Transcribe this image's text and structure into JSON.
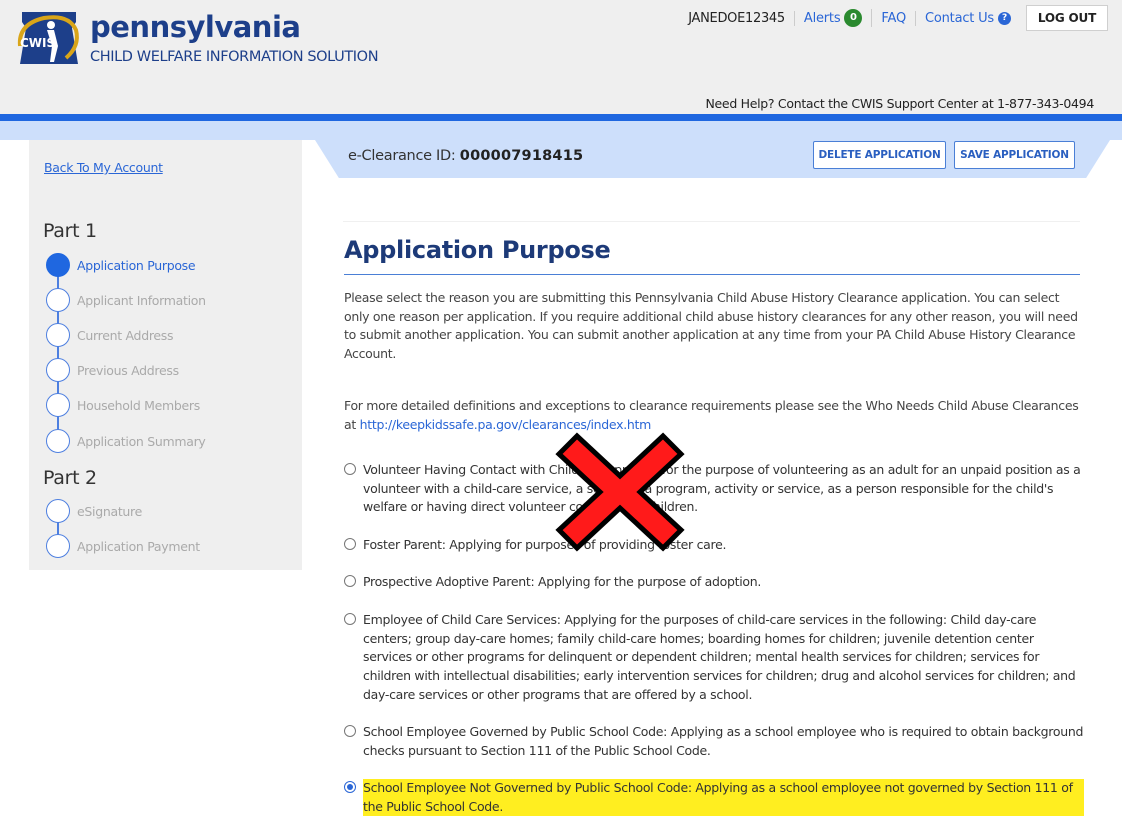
{
  "header": {
    "brand_name": "pennsylvania",
    "brand_subtitle": "CHILD WELFARE INFORMATION SOLUTION",
    "logo_text": "CWIS",
    "username": "JANEDOE12345",
    "alerts_label": "Alerts",
    "alerts_count": "0",
    "faq_label": "FAQ",
    "contact_label": "Contact Us",
    "contact_icon": "?",
    "logout_label": "LOG OUT",
    "support_text": "Need Help? Contact the CWIS Support Center at 1-877-343-0494"
  },
  "content_header": {
    "eclearance_label": "e-Clearance ID:",
    "eclearance_id": "000007918415",
    "delete_label": "DELETE APPLICATION",
    "save_label": "SAVE APPLICATION"
  },
  "sidebar": {
    "back_link": "Back To My Account",
    "parts": [
      {
        "title": "Part 1",
        "steps": [
          {
            "label": "Application Purpose",
            "active": true
          },
          {
            "label": "Applicant Information",
            "active": false
          },
          {
            "label": "Current Address",
            "active": false
          },
          {
            "label": "Previous Address",
            "active": false
          },
          {
            "label": "Household Members",
            "active": false
          },
          {
            "label": "Application Summary",
            "active": false
          }
        ]
      },
      {
        "title": "Part 2",
        "steps": [
          {
            "label": "eSignature",
            "active": false
          },
          {
            "label": "Application Payment",
            "active": false
          }
        ]
      }
    ]
  },
  "main": {
    "title": "Application Purpose",
    "intro": "Please select the reason you are submitting this Pennsylvania Child Abuse History Clearance application. You can select only one reason per application. If you require additional child abuse history clearances for any other reason, you will need to submit another application. You can submit another application at any time from your PA Child Abuse History Clearance Account.",
    "definitions_text": "For more detailed definitions and exceptions to clearance requirements please see the Who Needs Child Abuse Clearances at ",
    "definitions_link": "http://keepkidssafe.pa.gov/clearances/index.htm",
    "options": [
      {
        "text": "Volunteer Having Contact with Children: Applying for the purpose of volunteering as an adult for an unpaid position as a volunteer with a child-care service, a school or a program, activity or service, as a person responsible for the child's welfare or having direct volunteer contact with children.",
        "selected": false
      },
      {
        "text": "Foster Parent: Applying for purposes of providing foster care.",
        "selected": false
      },
      {
        "text": "Prospective Adoptive Parent: Applying for the purpose of adoption.",
        "selected": false
      },
      {
        "text": "Employee of Child Care Services: Applying for the purposes of child-care services in the following: Child day-care centers; group day-care homes; family child-care homes; boarding homes for children; juvenile detention center services or other programs for delinquent or dependent children; mental health services for children; services for children with intellectual disabilities; early intervention services for children; drug and alcohol services for children; and day-care services or other programs that are offered by a school.",
        "selected": false
      },
      {
        "text": "School Employee Governed by Public School Code: Applying as a school employee who is required to obtain background checks pursuant to Section 111 of the Public School Code.",
        "selected": false
      },
      {
        "text": "School Employee Not Governed by Public School Code: Applying as a school employee not governed by Section 111 of the Public School Code.",
        "selected": true
      }
    ]
  },
  "colors": {
    "brand_navy": "#1d3f8a",
    "accent_blue": "#1f67e0",
    "band_light_blue": "#cddffb",
    "highlight_yellow": "#ffee20",
    "overlay_red": "#ff1a1a"
  }
}
